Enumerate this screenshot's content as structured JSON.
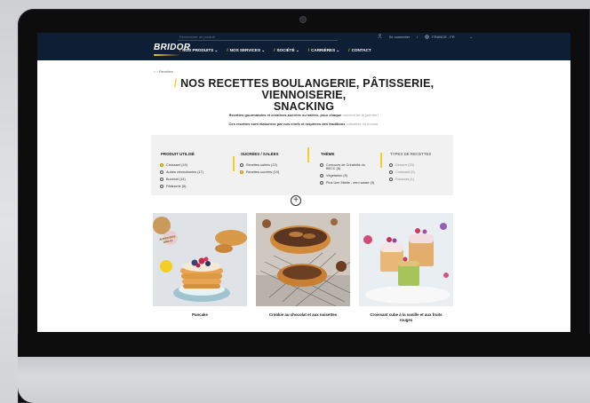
{
  "search": {
    "placeholder": "Rechercher un produit"
  },
  "top_links": {
    "login": "Se connecter",
    "country": "FRANCE - FR"
  },
  "brand": {
    "logo_text": "BRIDOR"
  },
  "nav": [
    {
      "label": "NOS PRODUITS"
    },
    {
      "label": "NOS SERVICES"
    },
    {
      "label": "SOCIÉTÉ"
    },
    {
      "label": "CARRIÈRES"
    },
    {
      "label": "CONTACT"
    }
  ],
  "breadcrumb": {
    "home": "⌂",
    "current": "Recettes"
  },
  "page": {
    "title_line1": "NOS RECETTES BOULANGERIE, PÂTISSERIE, VIENNOISERIE,",
    "title_line2": "SNACKING",
    "intro_1_bold": "Recettes gourmandes et créatives,sucrées ou salées, pour chaque",
    "intro_1_grey": "moment de la journée !",
    "intro_2_bold": "Ces recettes sont élaborées par nos chefs et inspirées des traditions",
    "intro_2_grey": "culinaires du monde."
  },
  "filters": {
    "produit": {
      "title": "PRODUIT UTILISÉ",
      "options": [
        "Croissant (19)",
        "Autres viennoiseries (17)",
        "Bunirroll (14)",
        "Pâtisserie (6)"
      ]
    },
    "sucrees": {
      "title": "SUCRÉES / SALÉES",
      "options": [
        "Recettes salées (23)",
        "Recettes sucrées (19)"
      ]
    },
    "theme": {
      "title": "THÈME",
      "options": [
        "Concours de Créativité du BECC (6)",
        "Végétarien (9)",
        "Plus Une Miette - zero waste (3)"
      ]
    },
    "types": {
      "title": "TYPES DE RECETTES",
      "options": [
        "Dessert (15)",
        "Croissant (2)",
        "Focaccia (1)"
      ]
    }
  },
  "recipes": [
    {
      "title": "Pancake",
      "badge": "SUPER BIKE BREAD"
    },
    {
      "title": "Crookie au chocolat et aux noisettes"
    },
    {
      "title": "Croissant cube à la vanille et aux fruits rouges"
    }
  ],
  "colors": {
    "navy": "#0e1e35",
    "accent_yellow": "#f3cf25"
  }
}
